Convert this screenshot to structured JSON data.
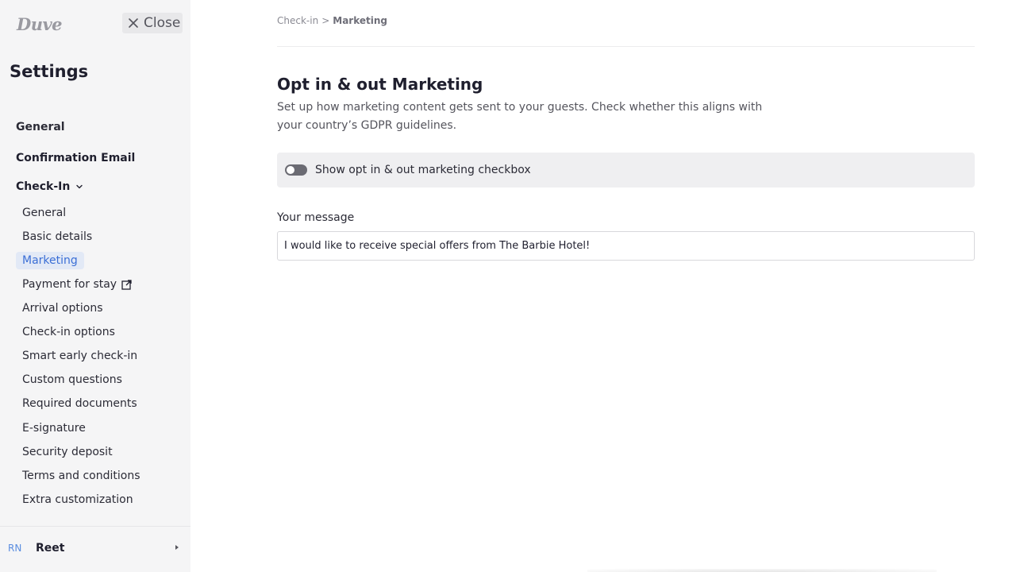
{
  "sidebar": {
    "logo_text": "Duve",
    "close_label": "Close",
    "title": "Settings",
    "nav": {
      "general": "General",
      "confirmation_email": "Confirmation Email",
      "check_in": "Check-In"
    },
    "check_in_items": [
      {
        "label": "General"
      },
      {
        "label": "Basic details"
      },
      {
        "label": "Marketing",
        "active": true
      },
      {
        "label": "Payment for stay",
        "external": true
      },
      {
        "label": "Arrival options"
      },
      {
        "label": "Check-in options"
      },
      {
        "label": "Smart early check-in"
      },
      {
        "label": "Custom questions"
      },
      {
        "label": "Required documents"
      },
      {
        "label": "E-signature"
      },
      {
        "label": "Security deposit"
      },
      {
        "label": "Terms and conditions"
      },
      {
        "label": "Extra customization"
      }
    ],
    "user": {
      "initials": "RN",
      "name": "Reet"
    }
  },
  "main": {
    "breadcrumb": {
      "parent": "Check-in",
      "separator": ">",
      "current": "Marketing"
    },
    "title": "Opt in & out Marketing",
    "description": "Set up how marketing content gets sent to your guests. Check whether this aligns with your country’s GDPR guidelines.",
    "toggle": {
      "label": "Show opt in & out marketing checkbox",
      "enabled": false
    },
    "message_field": {
      "label": "Your message",
      "value": "I would like to receive special offers from The Barbie Hotel!"
    }
  },
  "colors": {
    "accent": "#3b6fd6",
    "sidebar_bg": "#f5f5f6",
    "active_bg": "#e2e9f6"
  }
}
